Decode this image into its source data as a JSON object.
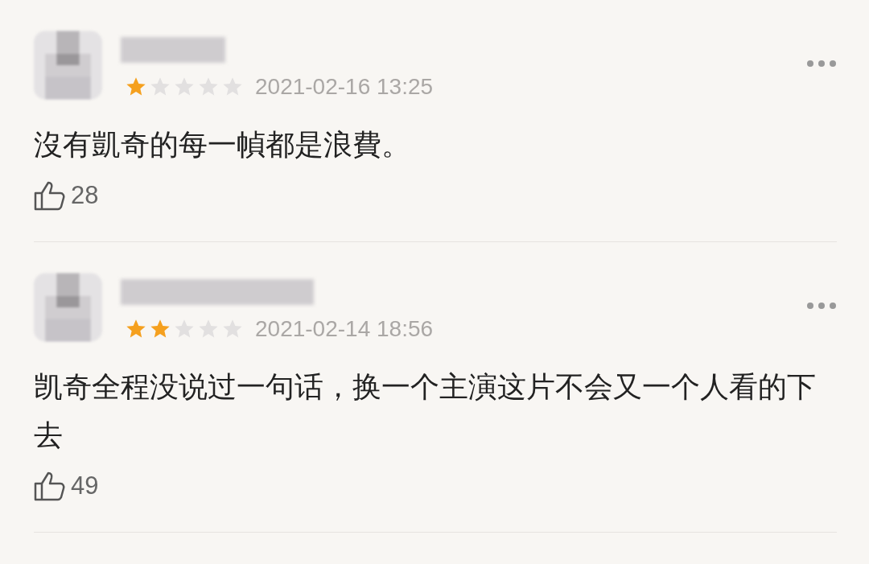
{
  "reviews": [
    {
      "stars": 1,
      "date": "2021-02-16 13:25",
      "comment": "沒有凱奇的每一幀都是浪費。",
      "likes": "28"
    },
    {
      "stars": 2,
      "date": "2021-02-14 18:56",
      "comment": "凯奇全程没说过一句话，换一个主演这片不会又一个人看的下去",
      "likes": "49"
    }
  ]
}
